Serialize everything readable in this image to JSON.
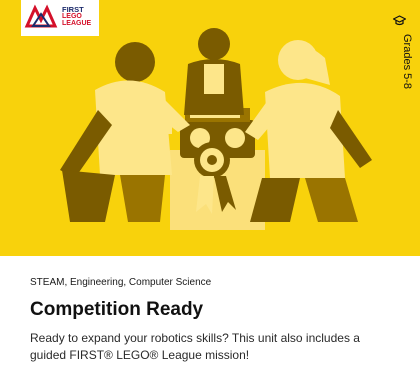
{
  "card": {
    "subjects": "STEAM, Engineering, Computer Science",
    "title": "Competition Ready",
    "description": "Ready to expand your robotics skills? This unit also includes a guided FIRST® LEGO® League mission!",
    "grade": "Grades 5-8",
    "grade_icon": "graduation-cap-icon"
  },
  "logo": {
    "brand_line1": "FIRST",
    "brand_line2": "LEGO",
    "brand_line3": "LEAGUE"
  },
  "colors": {
    "hero_background": "#f8d20c",
    "figure_dark": "#7a5b00",
    "figure_light": "#fde68a",
    "accent_red": "#d4102a",
    "accent_blue": "#1d2b6b"
  }
}
